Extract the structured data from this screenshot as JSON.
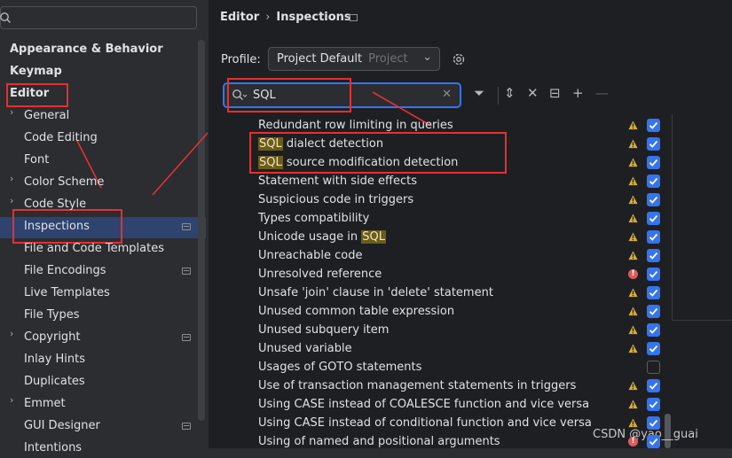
{
  "sidebar": {
    "search_placeholder": "",
    "items": [
      {
        "label": "Appearance & Behavior",
        "bold": true,
        "chevron": false,
        "pinned": false
      },
      {
        "label": "Keymap",
        "bold": true,
        "chevron": false,
        "pinned": false
      },
      {
        "label": "Editor",
        "bold": true,
        "chevron": false,
        "pinned": false
      },
      {
        "label": "General",
        "bold": false,
        "chevron": true,
        "pinned": false
      },
      {
        "label": "Code Editing",
        "bold": false,
        "chevron": false,
        "pinned": false
      },
      {
        "label": "Font",
        "bold": false,
        "chevron": false,
        "pinned": false
      },
      {
        "label": "Color Scheme",
        "bold": false,
        "chevron": true,
        "pinned": false
      },
      {
        "label": "Code Style",
        "bold": false,
        "chevron": true,
        "pinned": false
      },
      {
        "label": "Inspections",
        "bold": false,
        "chevron": false,
        "pinned": true,
        "selected": true
      },
      {
        "label": "File and Code Templates",
        "bold": false,
        "chevron": false,
        "pinned": false
      },
      {
        "label": "File Encodings",
        "bold": false,
        "chevron": false,
        "pinned": true
      },
      {
        "label": "Live Templates",
        "bold": false,
        "chevron": false,
        "pinned": false
      },
      {
        "label": "File Types",
        "bold": false,
        "chevron": false,
        "pinned": false
      },
      {
        "label": "Copyright",
        "bold": false,
        "chevron": true,
        "pinned": true
      },
      {
        "label": "Inlay Hints",
        "bold": false,
        "chevron": false,
        "pinned": false
      },
      {
        "label": "Duplicates",
        "bold": false,
        "chevron": false,
        "pinned": false
      },
      {
        "label": "Emmet",
        "bold": false,
        "chevron": true,
        "pinned": false
      },
      {
        "label": "GUI Designer",
        "bold": false,
        "chevron": false,
        "pinned": true
      },
      {
        "label": "Intentions",
        "bold": false,
        "chevron": false,
        "pinned": false
      }
    ]
  },
  "header": {
    "breadcrumb_parent": "Editor",
    "separator": "›",
    "breadcrumb_current": "Inspections"
  },
  "profile": {
    "label": "Profile:",
    "value": "Project Default",
    "scope": "Project"
  },
  "search": {
    "value": "SQL",
    "highlight_term": "SQL"
  },
  "toolbar": {
    "icons": [
      "filter-icon",
      "expand-all-icon",
      "collapse-all-icon",
      "reset-icon",
      "add-icon",
      "remove-icon"
    ]
  },
  "inspections": [
    {
      "text": "Redundant row limiting in queries",
      "severity": "warning",
      "checked": true
    },
    {
      "text": "SQL dialect detection",
      "severity": "warning",
      "checked": true
    },
    {
      "text": "SQL source modification detection",
      "severity": "warning",
      "checked": true
    },
    {
      "text": "Statement with side effects",
      "severity": "warning",
      "checked": true
    },
    {
      "text": "Suspicious code in triggers",
      "severity": "warning",
      "checked": true
    },
    {
      "text": "Types compatibility",
      "severity": "warning",
      "checked": true
    },
    {
      "text": "Unicode usage in SQL",
      "severity": "warning",
      "checked": true
    },
    {
      "text": "Unreachable code",
      "severity": "warning",
      "checked": true
    },
    {
      "text": "Unresolved reference",
      "severity": "error",
      "checked": true
    },
    {
      "text": "Unsafe 'join' clause in 'delete' statement",
      "severity": "warning",
      "checked": true
    },
    {
      "text": "Unused common table expression",
      "severity": "warning",
      "checked": true
    },
    {
      "text": "Unused subquery item",
      "severity": "warning",
      "checked": true
    },
    {
      "text": "Unused variable",
      "severity": "warning",
      "checked": true
    },
    {
      "text": "Usages of GOTO statements",
      "severity": "none",
      "checked": false
    },
    {
      "text": "Use of transaction management statements in triggers",
      "severity": "warning",
      "checked": true
    },
    {
      "text": "Using CASE instead of COALESCE function and vice versa",
      "severity": "warning",
      "checked": true
    },
    {
      "text": "Using CASE instead of conditional function and vice versa",
      "severity": "warning",
      "checked": true
    },
    {
      "text": "Using of named and positional arguments",
      "severity": "error",
      "checked": true
    }
  ],
  "watermark": "CSDN @yao__guai",
  "colors": {
    "accent": "#3574f0",
    "warning": "#d6ae40",
    "error": "#db5c5c",
    "annotation": "#e53030",
    "match_highlight": "#6b5c1c"
  }
}
